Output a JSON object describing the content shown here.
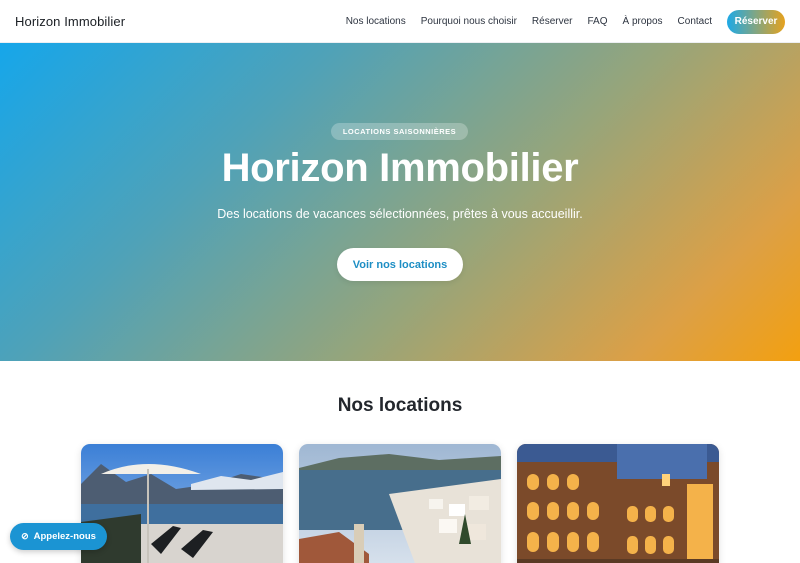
{
  "header": {
    "brand": "Horizon Immobilier",
    "nav": {
      "locations": "Nos locations",
      "why": "Pourquoi nous choisir",
      "book": "Réserver",
      "faq": "FAQ",
      "about": "À propos",
      "contact": "Contact"
    },
    "cta_label": "Réserver"
  },
  "hero": {
    "badge": "LOCATIONS SAISONNIÈRES",
    "title": "Horizon Immobilier",
    "subtitle": "Des locations de vacances sélectionnées, prêtes à vous accueillir.",
    "button_label": "Voir nos locations"
  },
  "listings": {
    "title": "Nos locations",
    "cards": [
      {
        "image": "lake-terrace-photo"
      },
      {
        "image": "coastal-town-photo"
      },
      {
        "image": "arcaded-courtyard-photo"
      }
    ]
  },
  "floating": {
    "call_label": "Appelez-nous",
    "call_icon": "phone-icon"
  },
  "colors": {
    "gradient_start": "#16a6ea",
    "gradient_end": "#f3a010",
    "call_button": "#1b94d3",
    "hero_button_text": "#1d8ec4"
  }
}
